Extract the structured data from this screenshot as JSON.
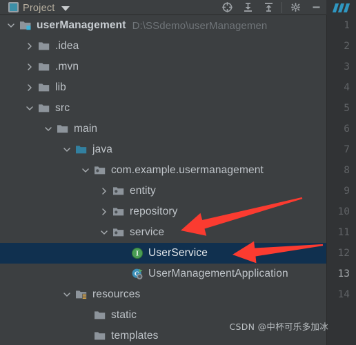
{
  "window": {
    "tool_window_title": "Project",
    "tool_window_icon": "project-panel-icon",
    "chevron_icon": "chevron-down-icon"
  },
  "toolbar": {
    "buttons": [
      {
        "name": "locate-icon",
        "label": ""
      },
      {
        "name": "collapse-all-icon",
        "label": ""
      },
      {
        "name": "expand-all-icon",
        "label": ""
      },
      {
        "name": "settings-gear-icon",
        "label": ""
      },
      {
        "name": "hide-panel-icon",
        "label": ""
      }
    ]
  },
  "tree": {
    "items": [
      {
        "label": "userManagement",
        "path": "D:\\SSdemo\\userManagemen",
        "indent": 0,
        "toggle": "expanded",
        "icon": "module-folder-icon",
        "bold": true,
        "selected": false
      },
      {
        "label": ".idea",
        "path": "",
        "indent": 1,
        "toggle": "collapsed",
        "icon": "folder-icon",
        "bold": false,
        "selected": false
      },
      {
        "label": ".mvn",
        "path": "",
        "indent": 1,
        "toggle": "collapsed",
        "icon": "folder-icon",
        "bold": false,
        "selected": false
      },
      {
        "label": "lib",
        "path": "",
        "indent": 1,
        "toggle": "collapsed",
        "icon": "folder-icon",
        "bold": false,
        "selected": false
      },
      {
        "label": "src",
        "path": "",
        "indent": 1,
        "toggle": "expanded",
        "icon": "folder-icon",
        "bold": false,
        "selected": false
      },
      {
        "label": "main",
        "path": "",
        "indent": 2,
        "toggle": "expanded",
        "icon": "folder-icon",
        "bold": false,
        "selected": false
      },
      {
        "label": "java",
        "path": "",
        "indent": 3,
        "toggle": "expanded",
        "icon": "source-root-icon",
        "bold": false,
        "selected": false
      },
      {
        "label": "com.example.usermanagement",
        "path": "",
        "indent": 4,
        "toggle": "expanded",
        "icon": "package-icon",
        "bold": false,
        "selected": false
      },
      {
        "label": "entity",
        "path": "",
        "indent": 5,
        "toggle": "collapsed",
        "icon": "package-icon",
        "bold": false,
        "selected": false
      },
      {
        "label": "repository",
        "path": "",
        "indent": 5,
        "toggle": "collapsed",
        "icon": "package-icon",
        "bold": false,
        "selected": false
      },
      {
        "label": "service",
        "path": "",
        "indent": 5,
        "toggle": "expanded",
        "icon": "package-icon",
        "bold": false,
        "selected": false
      },
      {
        "label": "UserService",
        "path": "",
        "indent": 6,
        "toggle": "none",
        "icon": "java-interface-icon",
        "bold": false,
        "selected": true
      },
      {
        "label": "UserManagementApplication",
        "path": "",
        "indent": 6,
        "toggle": "none",
        "icon": "spring-boot-run-class-icon",
        "bold": false,
        "selected": false
      },
      {
        "label": "resources",
        "path": "",
        "indent": 3,
        "toggle": "expanded",
        "icon": "resources-root-icon",
        "bold": false,
        "selected": false
      },
      {
        "label": "static",
        "path": "",
        "indent": 4,
        "toggle": "none",
        "icon": "folder-icon",
        "bold": false,
        "selected": false
      },
      {
        "label": "templates",
        "path": "",
        "indent": 4,
        "toggle": "none",
        "icon": "folder-icon",
        "bold": false,
        "selected": false
      }
    ]
  },
  "gutter": {
    "lines": [
      "1",
      "2",
      "3",
      "4",
      "5",
      "6",
      "7",
      "8",
      "9",
      "10",
      "11",
      "12",
      "13",
      "14"
    ],
    "active_line": "13"
  },
  "annotations": {
    "arrow_color": "#fb3b30",
    "arrows": [
      {
        "name": "arrow-to-service",
        "points_at": "service"
      },
      {
        "name": "arrow-to-userservice",
        "points_at": "UserService"
      }
    ]
  },
  "watermark": {
    "text": "CSDN @中杯可乐多加冰"
  },
  "colors": {
    "background": "#3c3f41",
    "gutter_background": "#313335",
    "selection": "#10304f",
    "text": "#bfc4c9",
    "muted_text": "#6f7478",
    "accent_blue": "#3c8fa8",
    "accent_green": "#499c54",
    "accent_orange": "#d9a343",
    "arrow_red": "#fb3b30"
  }
}
